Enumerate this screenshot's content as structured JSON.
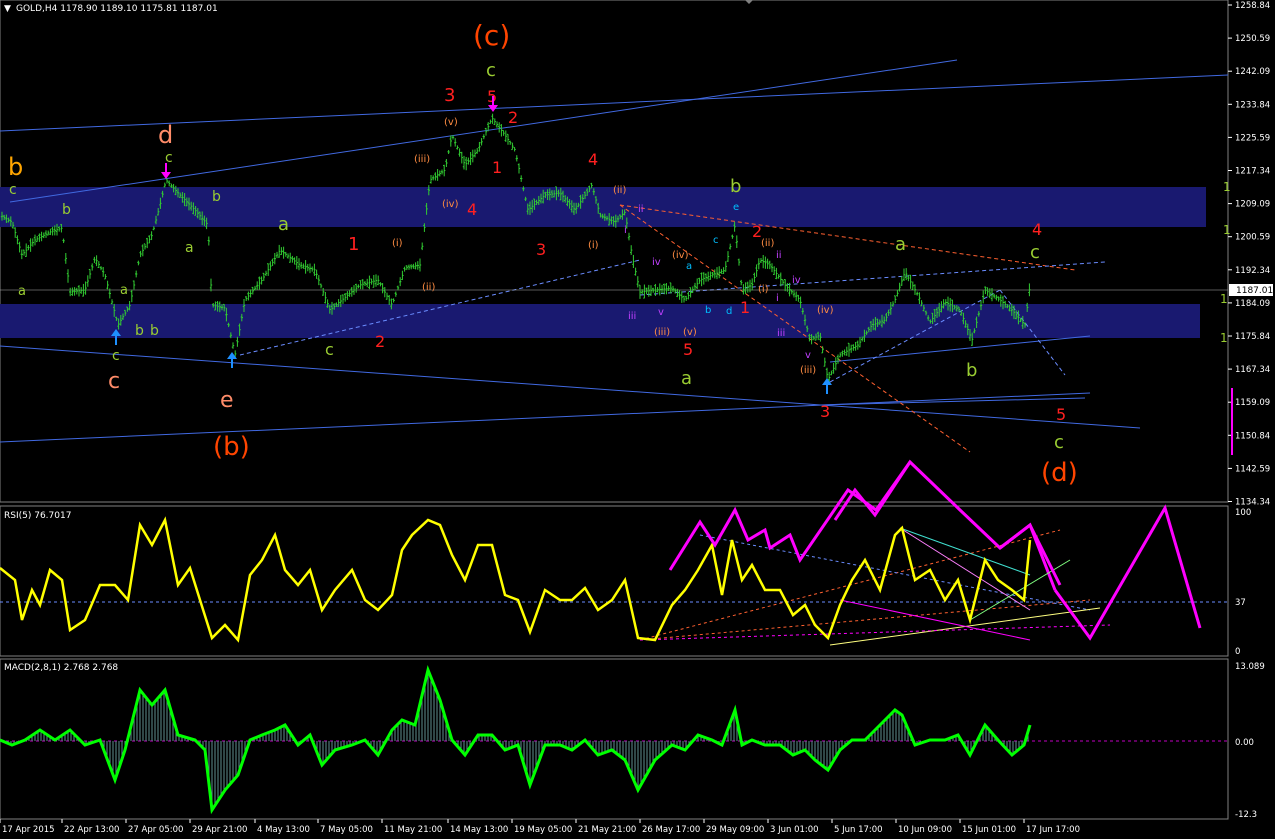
{
  "symbol_header": {
    "menu_arrow": "▼",
    "text": "GOLD,H4  1178.90 1189.10 1175.81 1187.01"
  },
  "price_axis": {
    "labels": [
      "1258.84",
      "1250.59",
      "1242.09",
      "1233.84",
      "1225.59",
      "1217.34",
      "1209.09",
      "1200.59",
      "1192.34",
      "1184.09",
      "1175.84",
      "1167.34",
      "1159.09",
      "1150.84",
      "1142.59",
      "1134.34"
    ],
    "current_price": "1187.01"
  },
  "time_axis": {
    "labels": [
      "17 Apr 2015",
      "22 Apr 13:00",
      "27 Apr 05:00",
      "29 Apr 21:00",
      "4 May 13:00",
      "7 May 05:00",
      "11 May 21:00",
      "14 May 13:00",
      "19 May 05:00",
      "21 May 21:00",
      "26 May 17:00",
      "29 May 09:00",
      "3 Jun 01:00",
      "5 Jun 17:00",
      "10 Jun 09:00",
      "15 Jun 01:00",
      "17 Jun 17:00"
    ]
  },
  "rsi": {
    "title": "RSI(5) 76.7017",
    "axis_labels": [
      "100",
      "37",
      "0"
    ]
  },
  "macd": {
    "title": "MACD(2,8,1) 2.768 2.768",
    "axis_labels": [
      "13.089",
      "0.00",
      "-12.3"
    ]
  },
  "wave_labels": [
    {
      "t": "b",
      "c": "#ffa500"
    },
    {
      "t": "c",
      "c": "#9acd32"
    },
    {
      "t": "a",
      "c": "#9acd32"
    },
    {
      "t": "b",
      "c": "#9acd32"
    },
    {
      "t": "d",
      "c": "#ff8c69"
    },
    {
      "t": "c",
      "c": "#9acd32"
    },
    {
      "t": "b",
      "c": "#9acd32"
    },
    {
      "t": "a",
      "c": "#9acd32"
    },
    {
      "t": "a",
      "c": "#9acd32"
    },
    {
      "t": "b",
      "c": "#9acd32"
    },
    {
      "t": "c",
      "c": "#9acd32"
    },
    {
      "t": "c",
      "c": "#ff8c69"
    },
    {
      "t": "b",
      "c": "#9acd32"
    },
    {
      "t": "a",
      "c": "#9acd32"
    },
    {
      "t": "c",
      "c": "#9acd32"
    },
    {
      "t": "e",
      "c": "#ff8c69"
    },
    {
      "t": "(b)",
      "c": "#ff4500"
    },
    {
      "t": "b",
      "c": "#9acd32"
    },
    {
      "t": "1",
      "c": "#ff2020"
    },
    {
      "t": "2",
      "c": "#ff2020"
    },
    {
      "t": "(i)",
      "c": "#ff8c42"
    },
    {
      "t": "(ii)",
      "c": "#ff8c42"
    },
    {
      "t": "(iii)",
      "c": "#ff8c42"
    },
    {
      "t": "(iv)",
      "c": "#ff8c42"
    },
    {
      "t": "(v)",
      "c": "#ff8c42"
    },
    {
      "t": "3",
      "c": "#ff2020"
    },
    {
      "t": "4",
      "c": "#ff2020"
    },
    {
      "t": "5",
      "c": "#ff2020"
    },
    {
      "t": "1",
      "c": "#ff2020"
    },
    {
      "t": "2",
      "c": "#ff2020"
    },
    {
      "t": "(c)",
      "c": "#ff4500"
    },
    {
      "t": "c",
      "c": "#9acd32"
    },
    {
      "t": "3",
      "c": "#ff2020"
    },
    {
      "t": "4",
      "c": "#ff2020"
    },
    {
      "t": "(ii)",
      "c": "#ff8c42"
    },
    {
      "t": "i",
      "c": "#c040ff"
    },
    {
      "t": "ii",
      "c": "#c040ff"
    },
    {
      "t": "(i)",
      "c": "#ff8c42"
    },
    {
      "t": "iv",
      "c": "#c040ff"
    },
    {
      "t": "iii",
      "c": "#c040ff"
    },
    {
      "t": "v",
      "c": "#c040ff"
    },
    {
      "t": "(iii)",
      "c": "#ff8c42"
    },
    {
      "t": "(iv)",
      "c": "#ff8c42"
    },
    {
      "t": "(v)",
      "c": "#ff8c42"
    },
    {
      "t": "5",
      "c": "#ff2020"
    },
    {
      "t": "a",
      "c": "#9acd32"
    },
    {
      "t": "a",
      "c": "#00bfff"
    },
    {
      "t": "b",
      "c": "#00bfff"
    },
    {
      "t": "c",
      "c": "#00bfff"
    },
    {
      "t": "d",
      "c": "#00bfff"
    },
    {
      "t": "e",
      "c": "#00bfff"
    },
    {
      "t": "b",
      "c": "#9acd32"
    },
    {
      "t": "1",
      "c": "#ff2020"
    },
    {
      "t": "2",
      "c": "#ff2020"
    },
    {
      "t": "(i)",
      "c": "#ff8c42"
    },
    {
      "t": "(ii)",
      "c": "#ff8c42"
    },
    {
      "t": "ii",
      "c": "#c040ff"
    },
    {
      "t": "i",
      "c": "#c040ff"
    },
    {
      "t": "iv",
      "c": "#c040ff"
    },
    {
      "t": "iii",
      "c": "#c040ff"
    },
    {
      "t": "(iv)",
      "c": "#ff8c42"
    },
    {
      "t": "v",
      "c": "#c040ff"
    },
    {
      "t": "(iii)",
      "c": "#ff8c42"
    },
    {
      "t": "3",
      "c": "#ff2020"
    },
    {
      "t": "a",
      "c": "#9acd32"
    },
    {
      "t": "b",
      "c": "#9acd32"
    },
    {
      "t": "4",
      "c": "#ff2020"
    },
    {
      "t": "c",
      "c": "#9acd32"
    },
    {
      "t": "5",
      "c": "#ff2020"
    },
    {
      "t": "c",
      "c": "#9acd32"
    },
    {
      "t": "(d)",
      "c": "#ff4500"
    },
    {
      "t": "1",
      "c": "#9acd32"
    },
    {
      "t": "1",
      "c": "#9acd32"
    },
    {
      "t": "1",
      "c": "#9acd32"
    },
    {
      "t": "1",
      "c": "#9acd32"
    }
  ],
  "colors": {
    "background": "#000000",
    "price": "#32cd32",
    "zone": "#191970",
    "trendline": "#4169e1",
    "rsi": "#ffff00",
    "macd": "#00ff00",
    "projection": "#ff00ff",
    "axis_text": "#ffffff"
  }
}
